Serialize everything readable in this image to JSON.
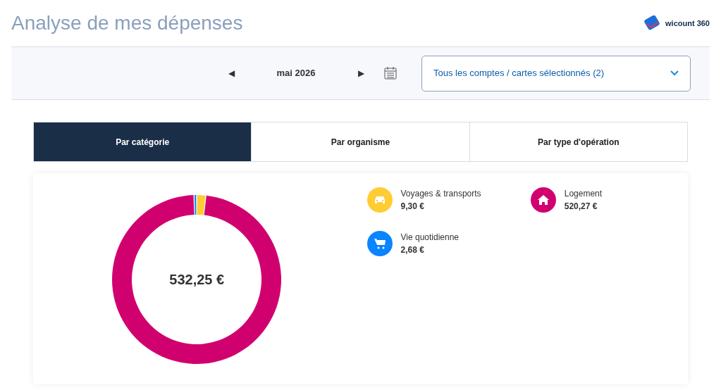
{
  "title": "Analyse de mes dépenses",
  "logo": {
    "text": "wicount 360"
  },
  "period": {
    "prev": "◀",
    "label": "mai 2026",
    "next": "▶"
  },
  "accounts_select": {
    "value": "Tous les comptes / cartes sélectionnés (2)"
  },
  "tabs": [
    {
      "label": "Par catégorie",
      "selected": true
    },
    {
      "label": "Par organisme",
      "selected": false
    },
    {
      "label": "Par type d'opération",
      "selected": false
    }
  ],
  "total": "532,25 €",
  "categories": [
    {
      "amount": "9,30 €",
      "color": "#ffcc33",
      "kind": "car"
    },
    {
      "amount": "520,27 €",
      "color": "#d1006f",
      "kind": "house"
    },
    {
      "amount": "2,68 €",
      "color": "#0a84ff",
      "kind": "cart"
    }
  ],
  "chart_data": {
    "type": "donut",
    "categories": [
      "Voyages & transports",
      "Logement",
      "Vie quotidienne"
    ],
    "values": [
      1.747,
      97.749,
      0.504
    ]
  }
}
